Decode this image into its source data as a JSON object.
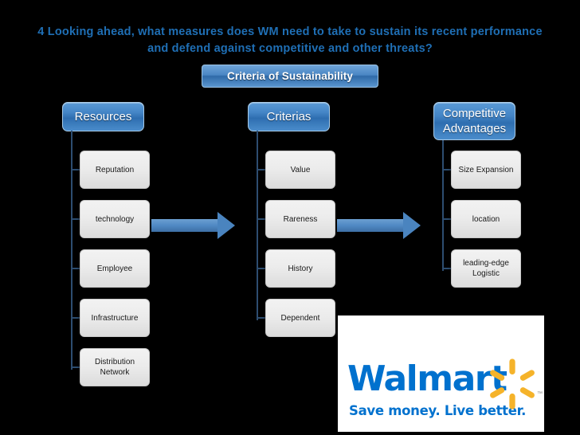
{
  "slide": {
    "background_color": "#000000",
    "title": "4 Looking ahead, what measures does WM need to take to sustain its recent performance and defend against competitive and other threats?",
    "title_color": "#1f6fb5",
    "header_pill": "Criteria of Sustainability",
    "accent_color": "#4485c6",
    "arrow_color": "#4a84bf"
  },
  "columns": [
    {
      "id": "resources",
      "header": "Resources",
      "items": [
        {
          "label": "Reputation"
        },
        {
          "label": "technology"
        },
        {
          "label": "Employee"
        },
        {
          "label": "Infrastructure"
        },
        {
          "label": "Distribution Network"
        }
      ]
    },
    {
      "id": "criterias",
      "header": "Criterias",
      "items": [
        {
          "label": "Value"
        },
        {
          "label": "Rareness"
        },
        {
          "label": "History"
        },
        {
          "label": "Dependent"
        }
      ]
    },
    {
      "id": "competitive-advantages",
      "header": "Competitive Advantages",
      "items": [
        {
          "label": "Size Expansion"
        },
        {
          "label": "location"
        },
        {
          "label": "leading-edge Logistic"
        }
      ]
    }
  ],
  "arrows": [
    {
      "id": "arrow-resources-to-criterias"
    },
    {
      "id": "arrow-criterias-to-advantages"
    }
  ],
  "logo": {
    "wordmark": "Walmart",
    "tagline": "Save money. Live better.",
    "trademark": "™",
    "blue": "#0071ce",
    "gold": "#f5b32a",
    "spark_ray_count": 6
  }
}
